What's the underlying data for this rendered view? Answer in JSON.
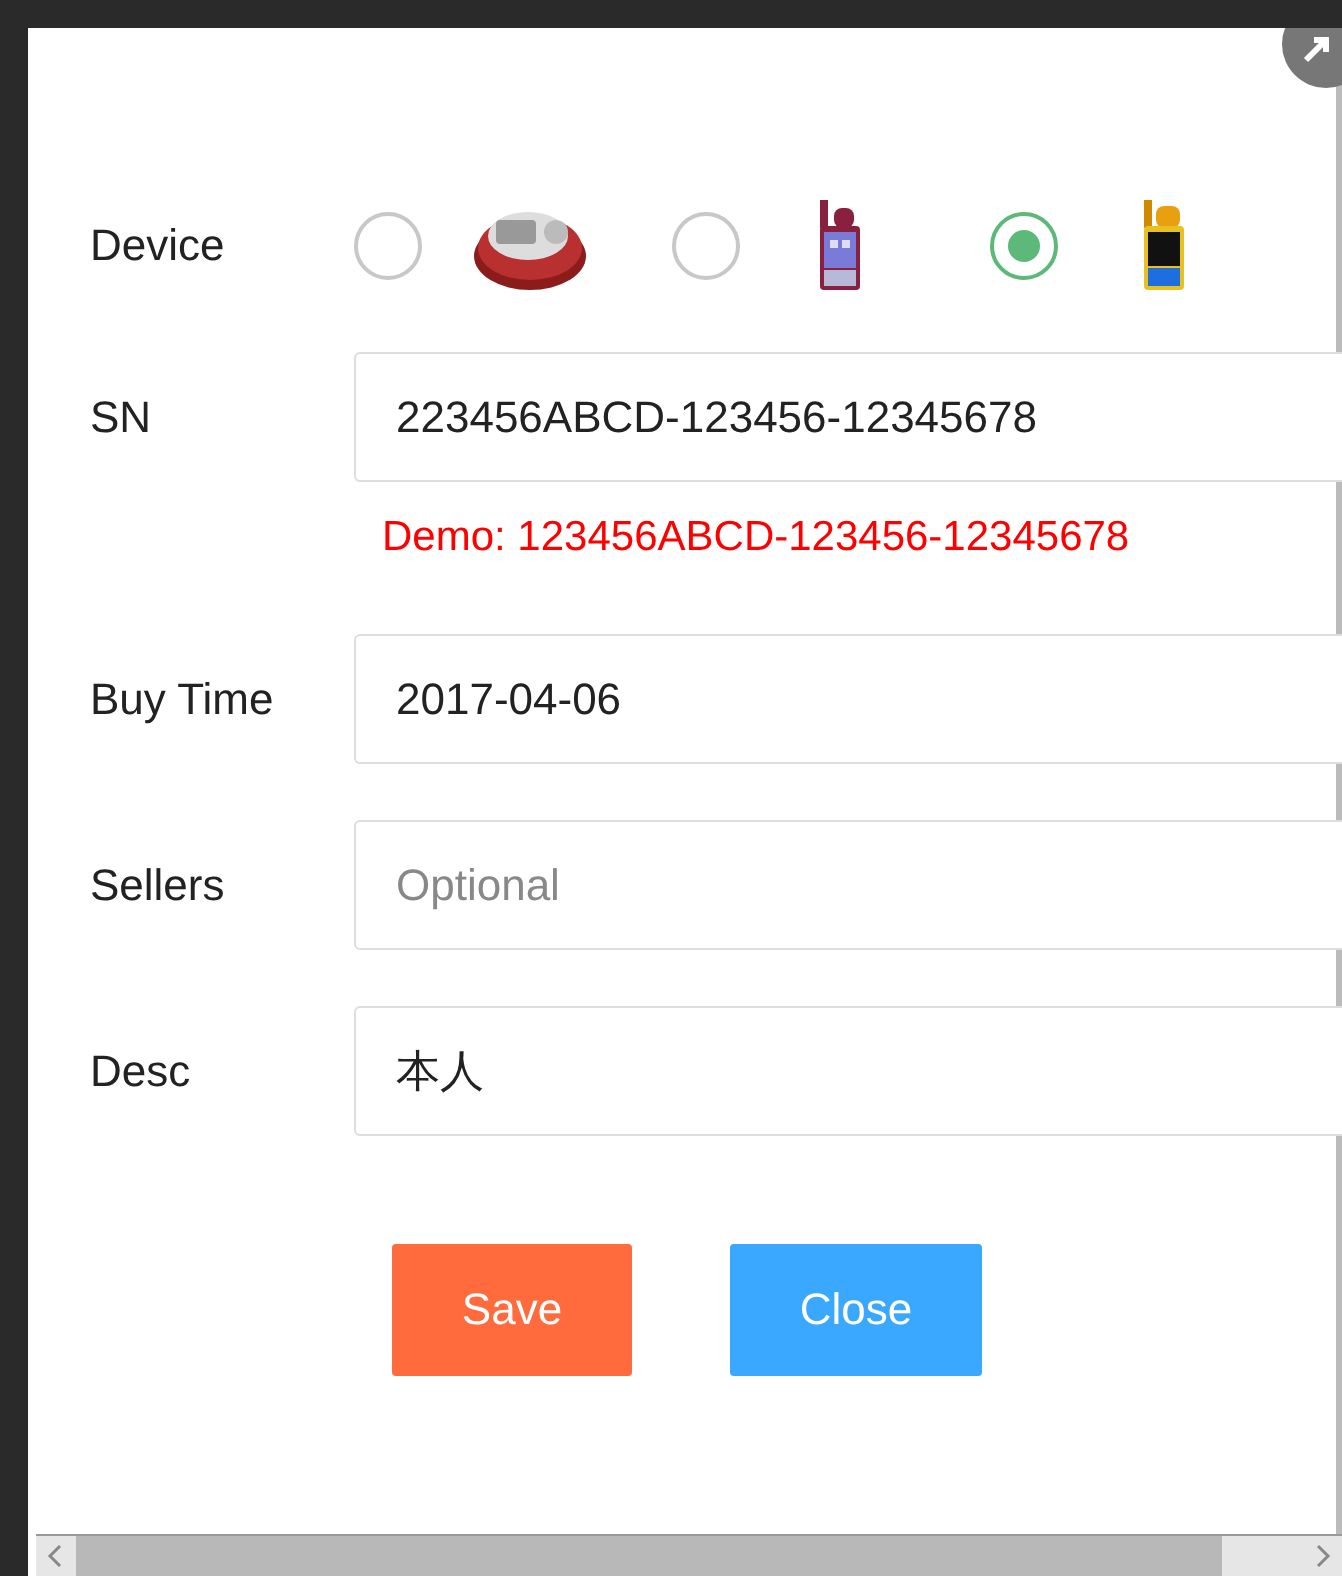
{
  "device": {
    "label": "Device",
    "options": [
      {
        "selected": false,
        "kind": "picture"
      },
      {
        "selected": false,
        "kind": "picture"
      },
      {
        "selected": true,
        "kind": "picture"
      }
    ]
  },
  "fields": [
    {
      "label": "SN",
      "value": "223456ABCD-123456-12345678",
      "hint": "Demo: 123456ABCD-123456-12345678"
    },
    {
      "label": "Buy Time",
      "value": "2017-04-06"
    },
    {
      "label": "Sellers",
      "placeholder": "Optional"
    },
    {
      "label": "Desc",
      "value": "本人"
    }
  ],
  "buttons": [
    {
      "label": "Save",
      "kind": "primary"
    },
    {
      "label": "Close",
      "kind": "secondary"
    }
  ]
}
